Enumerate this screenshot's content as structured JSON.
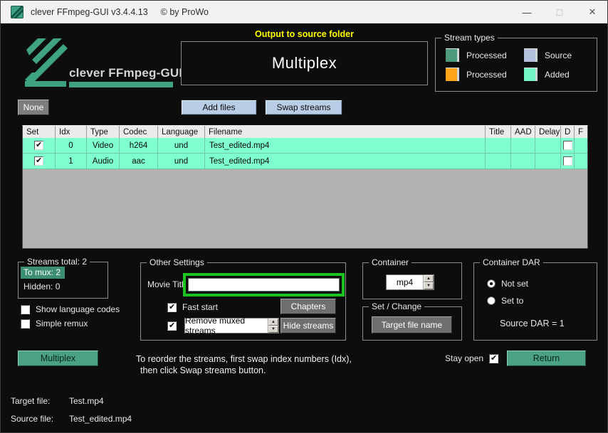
{
  "title_bar": {
    "title": "clever FFmpeg-GUI v3.4.4.13",
    "copyright": "© by ProWo",
    "minimize": "—",
    "maximize": "◻",
    "close": "✕"
  },
  "header": {
    "logo_text": "clever FFmpeg-GUI",
    "output_note": "Output to source folder",
    "mode_title": "Multiplex",
    "stream_types": {
      "label": "Stream types",
      "items": [
        {
          "label": "Processed",
          "color": "#4e9b7b"
        },
        {
          "label": "Source",
          "color": "#b3c0dc"
        },
        {
          "label": "Processed",
          "color": "#ffa416"
        },
        {
          "label": "Added",
          "color": "#70f7c5"
        }
      ]
    }
  },
  "toolbar": {
    "none_button": "None",
    "add_files_button": "Add files",
    "swap_streams_button": "Swap streams"
  },
  "table": {
    "columns": [
      "Set",
      "Idx",
      "Type",
      "Codec",
      "Language",
      "Filename",
      "Title",
      "AAD",
      "Delay",
      "D",
      "F"
    ],
    "rows": [
      {
        "set": true,
        "idx": "0",
        "type": "Video",
        "codec": "h264",
        "language": "und",
        "filename": "Test_edited.mp4",
        "title": "",
        "aad": "",
        "delay": "",
        "d": false,
        "f": ""
      },
      {
        "set": true,
        "idx": "1",
        "type": "Audio",
        "codec": "aac",
        "language": "und",
        "filename": "Test_edited.mp4",
        "title": "",
        "aad": "",
        "delay": "",
        "d": false,
        "f": ""
      }
    ]
  },
  "streams_panel": {
    "group_label": "Streams total:  2",
    "to_mux": "To mux:  2",
    "hidden": "Hidden:  0",
    "show_language_codes": "Show language codes",
    "simple_remux": "Simple remux",
    "multiplex_button": "Multiplex"
  },
  "other_settings": {
    "group_label": "Other Settings",
    "movie_title_label": "Movie Title",
    "movie_title_value": "",
    "fast_start": "Fast start",
    "chapters_button": "Chapters",
    "remove_muxed_streams": "Remove muxed streams",
    "hide_streams_button": "Hide streams"
  },
  "container_group": {
    "group_label": "Container",
    "value": "mp4"
  },
  "set_change_group": {
    "group_label": "Set / Change",
    "target_file_name_button": "Target file name"
  },
  "container_dar_group": {
    "group_label": "Container DAR",
    "not_set": "Not set",
    "set_to": "Set to",
    "source_dar": "Source DAR = 1",
    "selected": "Not set"
  },
  "footer": {
    "hint_line1": "To reorder the streams, first swap index numbers (Idx),",
    "hint_line2": "then click Swap streams button.",
    "stay_open_label": "Stay open",
    "stay_open_checked": true,
    "return_button": "Return",
    "target_file_label": "Target file:",
    "target_file_value": "Test.mp4",
    "source_file_label": "Source file:",
    "source_file_value": "Test_edited.mp4"
  },
  "colors": {
    "accent_teal": "#3fa383",
    "highlight_yellow": "#ffff00",
    "row_aqua": "#7fffd0",
    "button_blue": "#b9cde6",
    "movie_title_frame_green": "#1ec41e",
    "window_bg": "#0d0d0d",
    "titlebar_bg": "#f2f2f2"
  }
}
